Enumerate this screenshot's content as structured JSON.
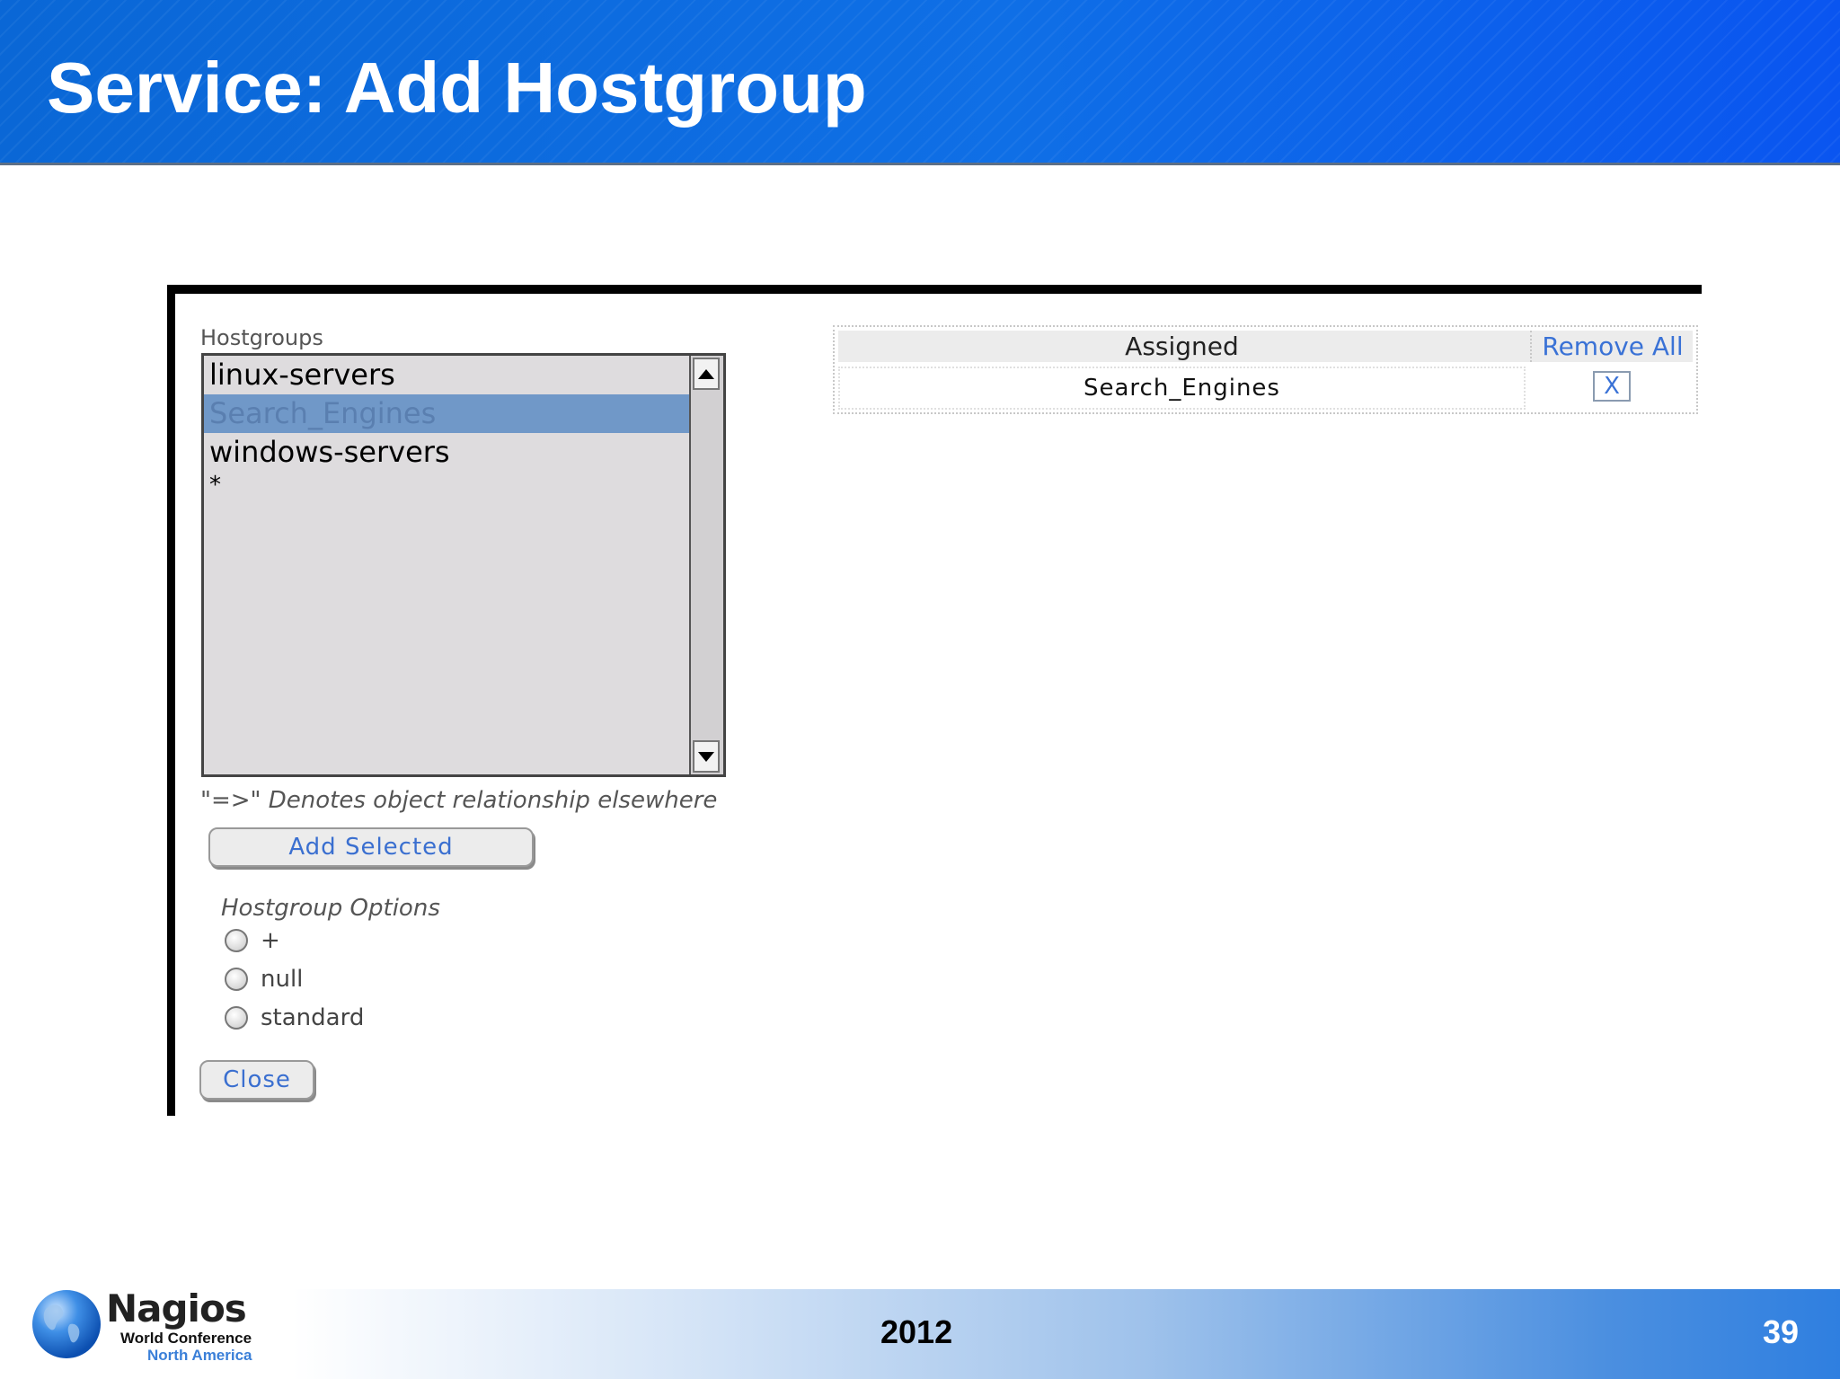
{
  "slide": {
    "title": "Service: Add Hostgroup",
    "footer_year": "2012",
    "page_number": "39",
    "logo": {
      "name": "Nagios",
      "line1": "World Conference",
      "line2": "North America"
    }
  },
  "form": {
    "hostgroups_label": "Hostgroups",
    "hostgroups": [
      {
        "label": "linux-servers",
        "selected": false
      },
      {
        "label": "Search_Engines",
        "selected": true
      },
      {
        "label": "windows-servers",
        "selected": false
      },
      {
        "label": "*",
        "selected": false
      }
    ],
    "note": "\"=>\" Denotes object relationship elsewhere",
    "add_selected_label": "Add Selected",
    "options_label": "Hostgroup Options",
    "options": [
      "+",
      "null",
      "standard"
    ],
    "close_label": "Close"
  },
  "assigned": {
    "header": "Assigned",
    "remove_all_label": "Remove All",
    "rows": [
      {
        "name": "Search_Engines",
        "remove_label": "X"
      }
    ]
  },
  "colors": {
    "header_blue": "#0a67d6",
    "selection": "#7098c8",
    "link_blue": "#3a72d6"
  }
}
